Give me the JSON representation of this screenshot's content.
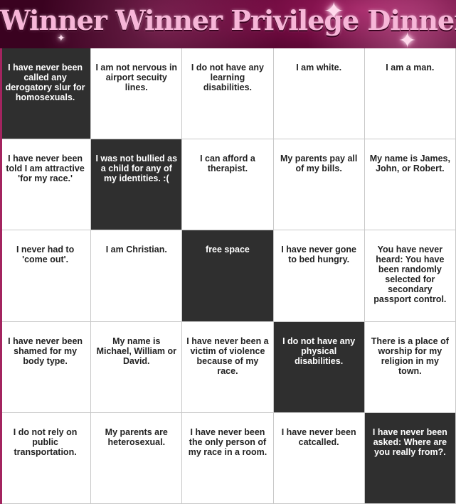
{
  "title": "Winner Winner Privilege Dinner",
  "colors": {
    "header_dark": "#3a0220",
    "header_mid": "#6d0a3e",
    "title_pink": "#f7b6d8",
    "marked_cell": "#2f2f2f",
    "unmarked_cell": "#ffffff"
  },
  "cells": [
    {
      "text": "I have never been called any derogatory slur for homosexuals.",
      "marked": true
    },
    {
      "text": "I am not nervous in airport secuity lines.",
      "marked": false
    },
    {
      "text": "I do not have any learning disabilities.",
      "marked": false
    },
    {
      "text": "I am white.",
      "marked": false
    },
    {
      "text": "I am a man.",
      "marked": false
    },
    {
      "text": "I have never been told I am attractive 'for my race.'",
      "marked": false
    },
    {
      "text": "I was not bullied as a child for any of my identities. :(",
      "marked": true
    },
    {
      "text": "I can afford a therapist.",
      "marked": false
    },
    {
      "text": "My parents pay all of my bills.",
      "marked": false
    },
    {
      "text": "My name is James, John, or Robert.",
      "marked": false
    },
    {
      "text": "I never had to 'come out'.",
      "marked": false
    },
    {
      "text": "I am Christian.",
      "marked": false
    },
    {
      "text": "free space",
      "marked": true
    },
    {
      "text": "I have never gone to bed hungry.",
      "marked": false
    },
    {
      "text": "You have never heard: You have been randomly selected for secondary passport control.",
      "marked": false
    },
    {
      "text": "I have never been shamed for my body type.",
      "marked": false
    },
    {
      "text": "My name is Michael, William or David.",
      "marked": false
    },
    {
      "text": "I have never been a victim of violence because of my race.",
      "marked": false
    },
    {
      "text": "I do not have any physical disabilities.",
      "marked": true
    },
    {
      "text": "There is a place of worship for my religion in my town.",
      "marked": false
    },
    {
      "text": "I do not rely on public transportation.",
      "marked": false
    },
    {
      "text": "My parents are heterosexual.",
      "marked": false
    },
    {
      "text": "I have never been the only person of my race in a room.",
      "marked": false
    },
    {
      "text": "I have never been catcalled.",
      "marked": false
    },
    {
      "text": "I have never been asked: Where are you really from?.",
      "marked": true
    }
  ]
}
